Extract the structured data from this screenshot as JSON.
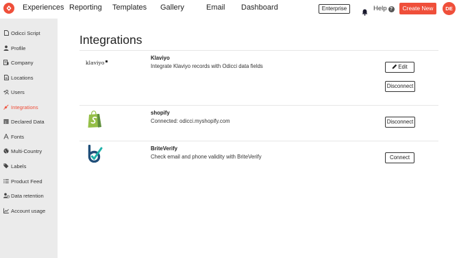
{
  "nav": {
    "items": [
      {
        "label": "Experiences"
      },
      {
        "label": "Reporting"
      },
      {
        "label": "Templates"
      },
      {
        "label": "Gallery"
      },
      {
        "label": "Email"
      },
      {
        "label": "Dashboard"
      }
    ],
    "enterprise_label": "Enterprise",
    "help_label": "Help",
    "help_icon_glyph": "?",
    "create_new_label": "Create New",
    "avatar_initials": "DE"
  },
  "sidebar": {
    "items": [
      {
        "label": "Odicci Script",
        "icon": "file-icon"
      },
      {
        "label": "Profile",
        "icon": "user-icon"
      },
      {
        "label": "Company",
        "icon": "building-icon"
      },
      {
        "label": "Locations",
        "icon": "document-icon"
      },
      {
        "label": "Users",
        "icon": "user-plus-icon"
      },
      {
        "label": "Integrations",
        "icon": "plug-icon",
        "active": true
      },
      {
        "label": "Declared Data",
        "icon": "table-icon"
      },
      {
        "label": "Fonts",
        "icon": "font-icon"
      },
      {
        "label": "Multi-Country",
        "icon": "globe-icon"
      },
      {
        "label": "Labels",
        "icon": "tags-icon"
      },
      {
        "label": "Product Feed",
        "icon": "list-icon"
      },
      {
        "label": "Data retention",
        "icon": "user-clock-icon"
      },
      {
        "label": "Account usage",
        "icon": "chart-icon"
      }
    ]
  },
  "main": {
    "title": "Integrations",
    "integrations": [
      {
        "name": "Klaviyo",
        "description": "Integrate Klaviyo records with Odicci data fields",
        "logo_text": "klaviyo",
        "buttons": [
          "Edit",
          "Disconnect"
        ]
      },
      {
        "name": "shopify",
        "description": "Connected: odicci.myshopify.com",
        "buttons": [
          "Disconnect"
        ]
      },
      {
        "name": "BriteVerify",
        "description": "Check email and phone validity with BriteVerify",
        "buttons": [
          "Connect"
        ]
      }
    ]
  },
  "colors": {
    "accent": "#ef4f3a",
    "sidebar_bg": "#ebebeb",
    "shopify_green": "#95bf47",
    "briteverify_blue": "#1f4e79",
    "briteverify_teal": "#20b2aa"
  }
}
